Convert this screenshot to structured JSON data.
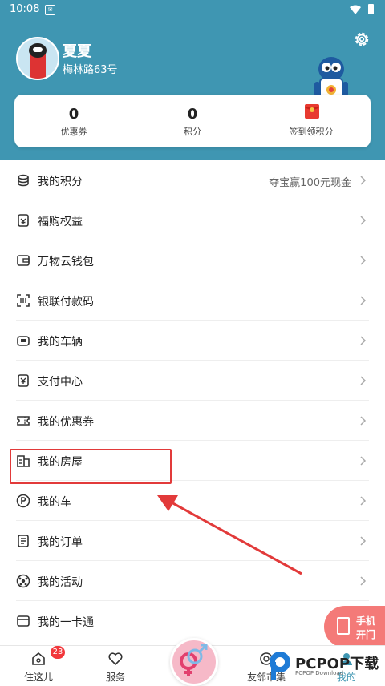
{
  "status_bar": {
    "time": "10:08"
  },
  "profile": {
    "name": "夏夏",
    "address": "梅林路63号"
  },
  "stats": [
    {
      "value": "0",
      "label": "优惠券"
    },
    {
      "value": "0",
      "label": "积分"
    },
    {
      "label": "签到领积分"
    }
  ],
  "menu": [
    {
      "label": "我的积分",
      "extra": "夺宝赢100元现金",
      "icon": "coins-icon"
    },
    {
      "label": "福购权益",
      "icon": "benefit-icon"
    },
    {
      "label": "万物云钱包",
      "icon": "wallet-icon"
    },
    {
      "label": "银联付款码",
      "icon": "scan-code-icon"
    },
    {
      "label": "我的车辆",
      "icon": "car-icon"
    },
    {
      "label": "支付中心",
      "icon": "payment-icon"
    },
    {
      "label": "我的优惠券",
      "icon": "ticket-icon"
    },
    {
      "label": "我的房屋",
      "icon": "building-icon"
    },
    {
      "label": "我的车",
      "icon": "parking-icon"
    },
    {
      "label": "我的订单",
      "icon": "order-icon"
    },
    {
      "label": "我的活动",
      "icon": "activity-icon"
    },
    {
      "label": "我的一卡通",
      "icon": "card-icon"
    }
  ],
  "door_button": {
    "line1": "手机",
    "line2": "开门"
  },
  "tabs": [
    {
      "label": "住这儿",
      "badge": "23"
    },
    {
      "label": "服务"
    },
    {
      "label": "友邻市集"
    },
    {
      "label": "我的"
    }
  ],
  "watermark": {
    "text": "PCPOP下载",
    "sub": "PCPOP Download"
  },
  "colors": {
    "header": "#3f96b2",
    "highlight": "#e23a3a",
    "door": "#f47a78",
    "badge": "#f2373b"
  }
}
